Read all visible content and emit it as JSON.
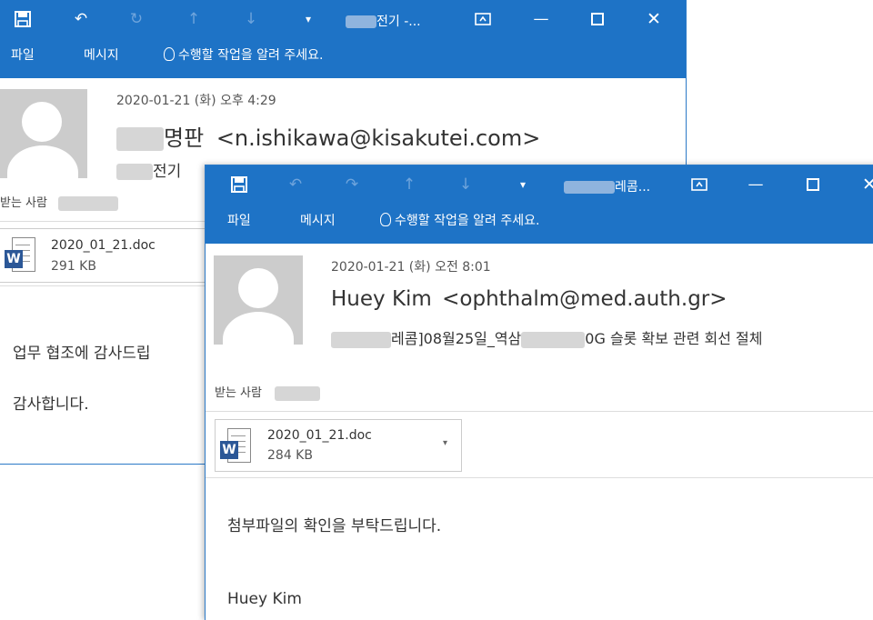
{
  "colors": {
    "titlebar": "#1e73c6",
    "accent": "#2b79c7"
  },
  "back_window": {
    "title_prefix": "",
    "title": "전기 -...",
    "menu": {
      "file": "파일",
      "message": "메시지",
      "tell_me": "수행할 작업을 알려 주세요."
    },
    "date": "2020-01-21 (화) 오후 4:29",
    "sender_name": "명판",
    "sender_email": "<n.ishikawa@kisakutei.com>",
    "subject": "전기",
    "to_label": "받는 사람",
    "attachment": {
      "name": "2020_01_21.doc",
      "size": "291 KB",
      "icon": "word-doc-icon"
    },
    "body_line1": "업무 협조에 감사드립",
    "body_line2": "감사합니다."
  },
  "front_window": {
    "title": "레콤...",
    "menu": {
      "file": "파일",
      "message": "메시지",
      "tell_me": "수행할 작업을 알려 주세요."
    },
    "date": "2020-01-21 (화) 오전 8:01",
    "sender_name": "Huey Kim",
    "sender_email": "<ophthalm@med.auth.gr>",
    "subject_part1": "레콤]08월25일_역삼",
    "subject_part2": "0G 슬롯 확보 관련 회선 절체",
    "to_label": "받는 사람",
    "attachment": {
      "name": "2020_01_21.doc",
      "size": "284 KB",
      "icon": "word-doc-icon"
    },
    "body_line1": "첨부파일의 확인을 부탁드립니다.",
    "body_line2": "Huey Kim"
  }
}
